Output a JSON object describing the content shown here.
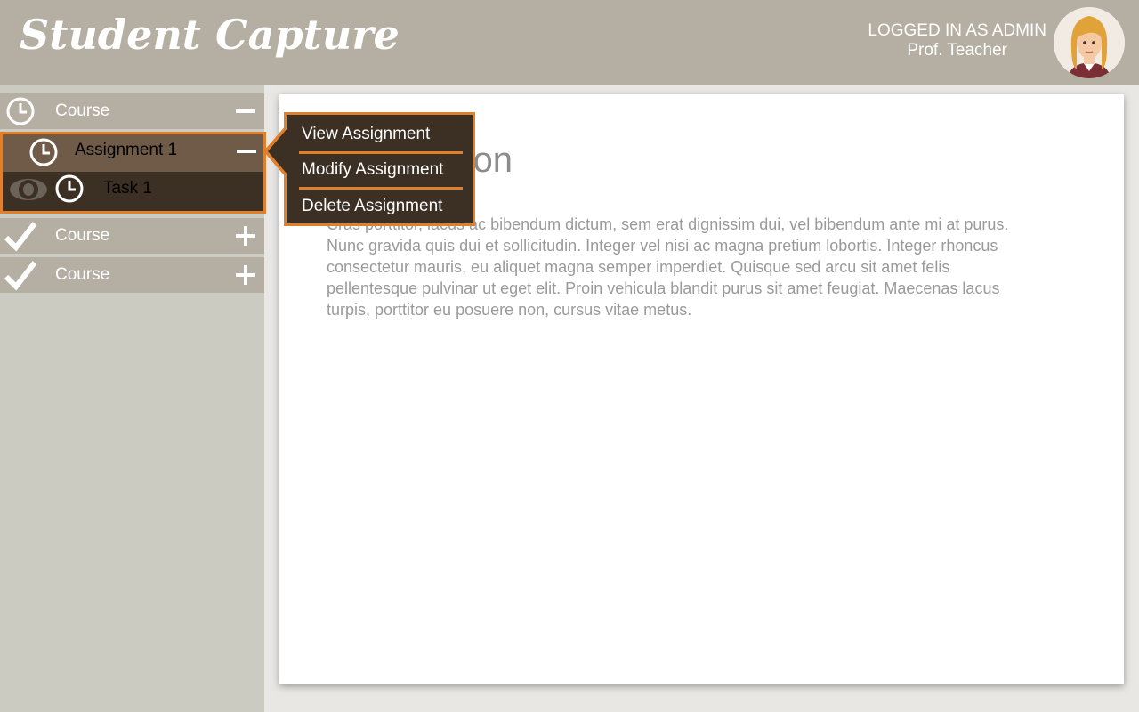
{
  "header": {
    "logo_text": "Student Capture",
    "user_role": "LOGGED IN AS ADMIN",
    "user_name": "Prof. Teacher"
  },
  "sidebar": {
    "course1": {
      "label": "Course",
      "icon": "clock-icon",
      "toggle": "collapse"
    },
    "assignment": {
      "label": "Assignment 1",
      "icon": "clock-icon",
      "toggle": "collapse"
    },
    "task": {
      "label": "Task 1",
      "icon": "clock-icon",
      "visibility_icon": "eye-icon"
    },
    "course2": {
      "label": "Course",
      "icon": "check-icon",
      "toggle": "expand"
    },
    "course3": {
      "label": "Course",
      "icon": "check-icon",
      "toggle": "expand"
    }
  },
  "popup": {
    "items": [
      "View Assignment",
      "Modify Assignment",
      "Delete Assignment"
    ]
  },
  "content": {
    "title": "Introduction",
    "body": "Cras porttitor, lacus ac bibendum dictum, sem erat dignissim dui, vel bibendum ante mi at purus. Nunc gravida quis dui et sollicitudin. Integer vel nisi ac magna pretium lobortis. Integer rhoncus consectetur mauris, eu aliquet magna semper imperdiet. Quisque sed arcu sit amet felis pellentesque pulvinar ut eget elit. Proin vehicula blandit purus sit amet feugiat. Maecenas lacus turpis, porttitor eu posuere non, cursus vitae metus."
  },
  "colors": {
    "header_bg": "#b5aea2",
    "sidebar_bg": "#cccbc2",
    "accent_orange": "#e07f2c",
    "dark_brown": "#3c2f24",
    "mid_brown": "#6f5b47"
  }
}
